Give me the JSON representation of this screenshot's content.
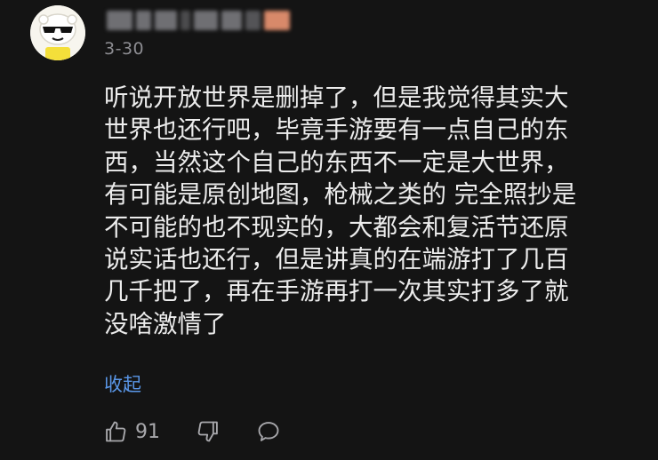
{
  "comment": {
    "date": "3-30",
    "lines": [
      "听说开放世界是删掉了，但是我觉得其实大",
      "世界也还行吧，毕竟手游要有一点自己的东",
      "西，当然这个自己的东西不一定是大世界，",
      "有可能是原创地图，枪械之类的 完全照抄是",
      "不可能的也不现实的，大都会和复活节还原",
      "说实话也还行，但是讲真的在端游打了几百",
      "几千把了，再在手游再打一次其实打多了就",
      "没啥激情了"
    ],
    "collapse_label": "收起",
    "likes": "91"
  },
  "icons": {
    "like": "thumbs-up-icon",
    "dislike": "thumbs-down-icon",
    "reply": "speech-bubble-icon"
  },
  "colors": {
    "background": "#141414",
    "text": "#ececec",
    "muted": "#8d8d92",
    "link": "#5a97e8"
  }
}
